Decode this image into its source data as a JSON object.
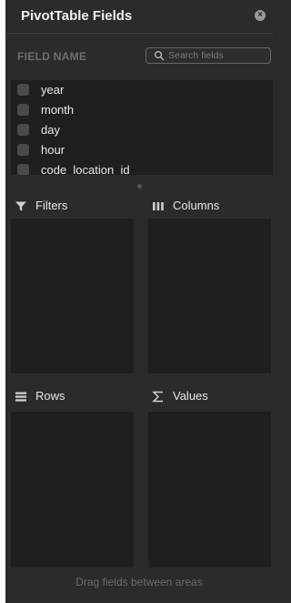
{
  "panel": {
    "title": "PivotTable Fields",
    "close_icon": "×"
  },
  "field_section": {
    "label": "FIELD NAME",
    "search_placeholder": "Search fields"
  },
  "fields": [
    {
      "name": "year",
      "checked": false
    },
    {
      "name": "month",
      "checked": false
    },
    {
      "name": "day",
      "checked": false
    },
    {
      "name": "hour",
      "checked": false
    },
    {
      "name": "code_location_id",
      "checked": false
    }
  ],
  "areas": {
    "filters": {
      "label": "Filters",
      "icon": "filter-icon"
    },
    "columns": {
      "label": "Columns",
      "icon": "columns-icon"
    },
    "rows": {
      "label": "Rows",
      "icon": "rows-icon"
    },
    "values": {
      "label": "Values",
      "icon": "sigma-icon"
    }
  },
  "footer": {
    "hint": "Drag fields between areas"
  }
}
